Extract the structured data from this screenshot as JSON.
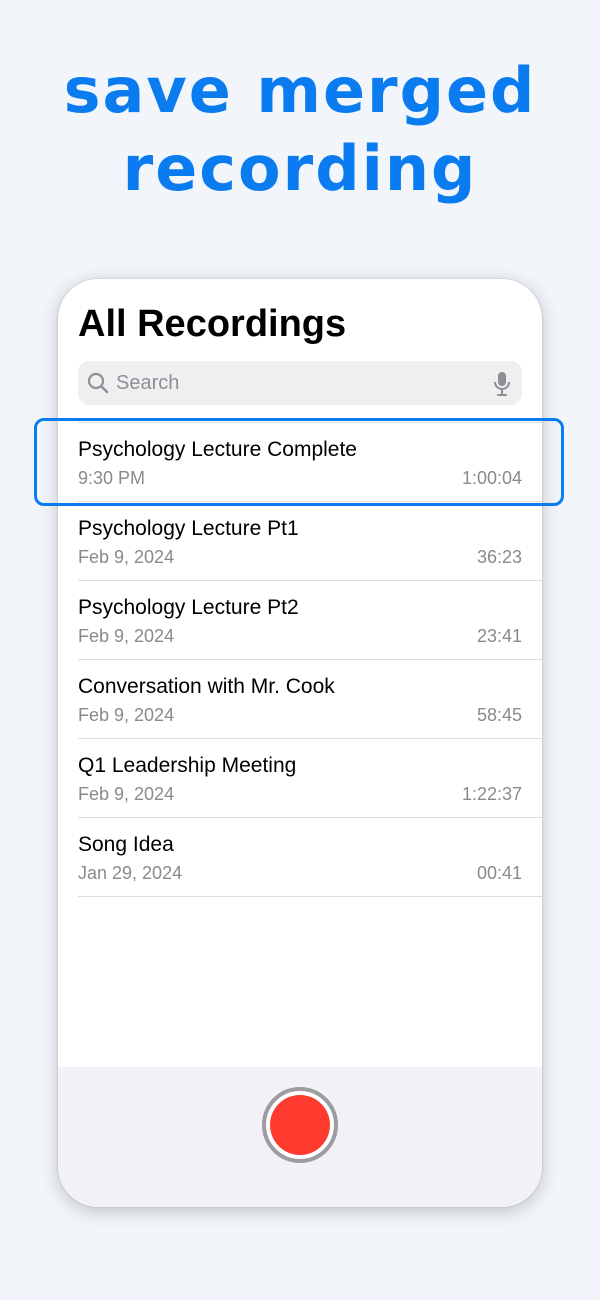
{
  "headline": {
    "line1": "save merged",
    "line2": "recording"
  },
  "screen": {
    "title": "All Recordings",
    "search": {
      "placeholder": "Search",
      "search_icon": "magnifying-glass-icon",
      "mic_icon": "microphone-icon"
    },
    "recordings": [
      {
        "name": "Psychology Lecture Complete",
        "date": "9:30 PM",
        "duration": "1:00:04",
        "highlighted": true
      },
      {
        "name": "Psychology Lecture Pt1",
        "date": "Feb 9, 2024",
        "duration": "36:23"
      },
      {
        "name": "Psychology Lecture Pt2",
        "date": "Feb 9, 2024",
        "duration": "23:41"
      },
      {
        "name": "Conversation with Mr. Cook",
        "date": "Feb 9, 2024",
        "duration": "58:45"
      },
      {
        "name": "Q1 Leadership Meeting",
        "date": "Feb 9, 2024",
        "duration": "1:22:37"
      },
      {
        "name": "Song Idea",
        "date": "Jan 29, 2024",
        "duration": "00:41"
      }
    ],
    "record_button_icon": "record-icon"
  },
  "colors": {
    "accent": "#0b7cf0",
    "record": "#ff3b30",
    "background": "#f2f6fb"
  }
}
